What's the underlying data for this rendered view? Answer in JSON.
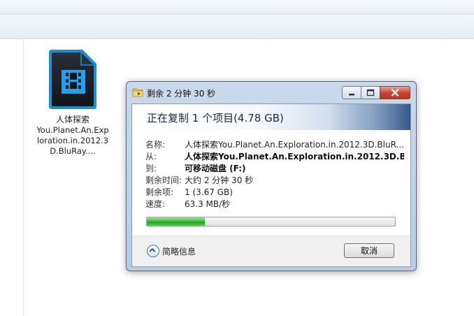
{
  "file": {
    "name_line1": "人体探索",
    "name_rest": "You.Planet.An.Exploration.in.2012.3D.BluRay...."
  },
  "dialog": {
    "title": "剩余 2 分钟 30 秒",
    "heading": "正在复制 1 个项目(4.78 GB)",
    "details": {
      "name_label": "名称:",
      "name_value": "人体探索You.Planet.An.Exploration.in.2012.3D.BluR...",
      "from_label": "从:",
      "from_value": "人体探索You.Planet.An.Exploration.in.2012.3D.Blu",
      "to_label": "到:",
      "to_value": "可移动磁盘 (F:)",
      "time_left_label": "剩余时间:",
      "time_left_value": "大约 2 分钟 30 秒",
      "items_left_label": "剩余项:",
      "items_left_value": "1 (3.67 GB)",
      "speed_label": "速度:",
      "speed_value": "63.3 MB/秒"
    },
    "progress": 0.235,
    "less_info_label": "简略信息",
    "cancel_label": "取消"
  },
  "colors": {
    "progress_green": "#2fb52c",
    "header_dark": "#35598b",
    "close_red": "#c7442f"
  },
  "icons": [
    "video-file-icon",
    "copy-folder-icon",
    "minimize-icon",
    "maximize-icon",
    "close-icon",
    "chevron-up-icon"
  ]
}
